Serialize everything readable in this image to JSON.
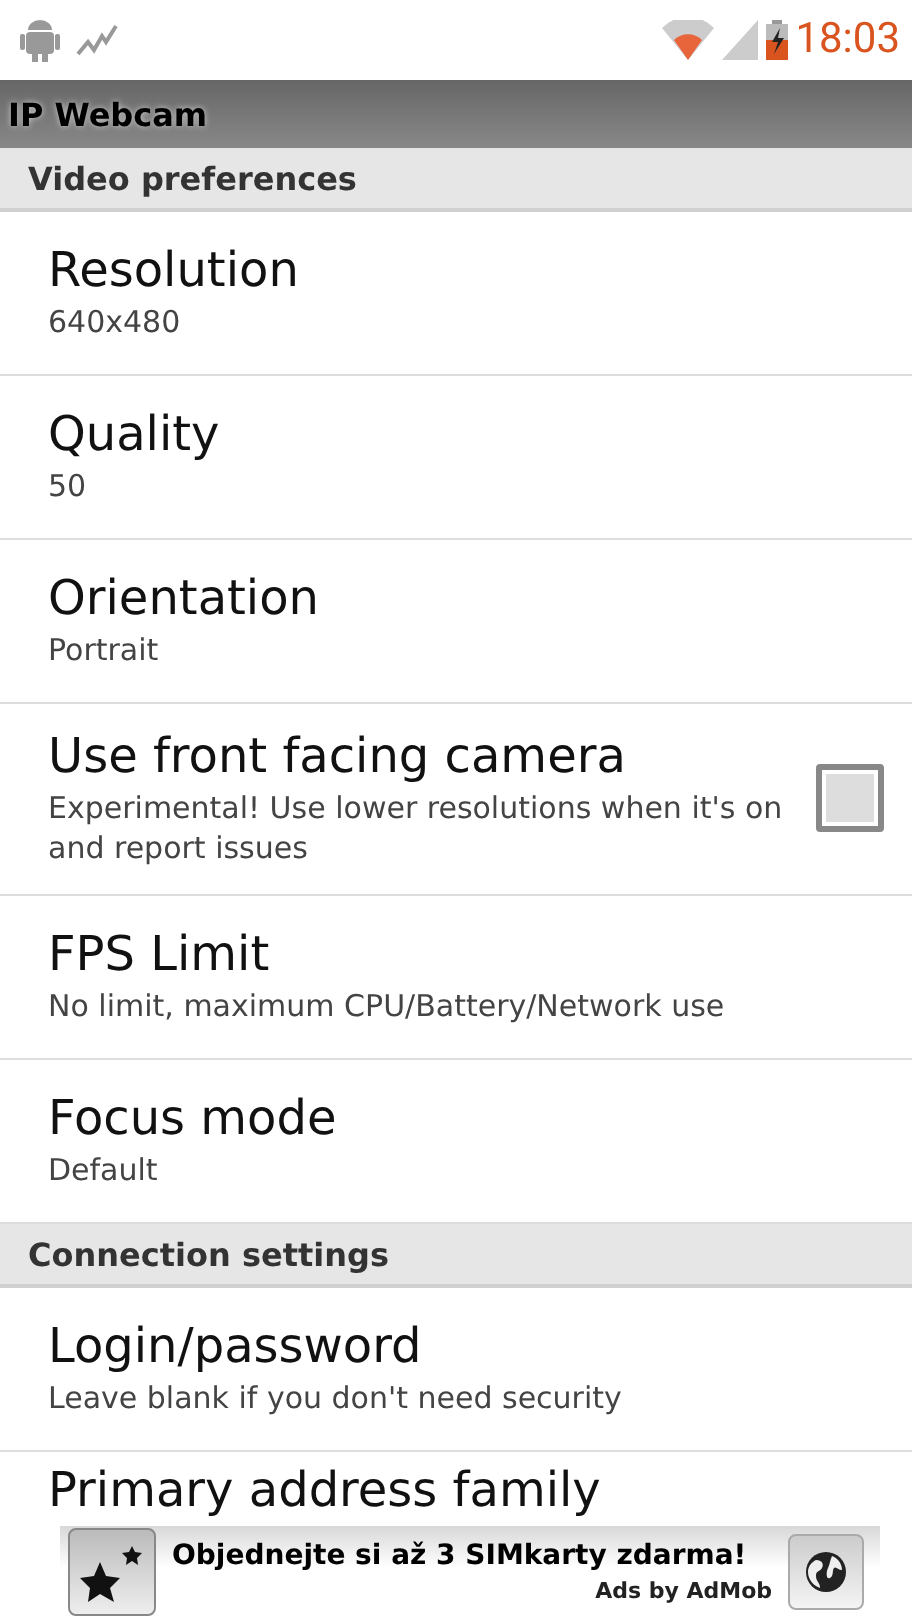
{
  "status_bar": {
    "time": "18:03"
  },
  "app_bar": {
    "title": "IP Webcam"
  },
  "sections": [
    {
      "title": "Video preferences",
      "items": [
        {
          "kind": "text",
          "title": "Resolution",
          "summary": "640x480"
        },
        {
          "kind": "text",
          "title": "Quality",
          "summary": "50"
        },
        {
          "kind": "text",
          "title": "Orientation",
          "summary": "Portrait"
        },
        {
          "kind": "checkbox",
          "title": "Use front facing camera",
          "summary": "Experimental! Use lower resolutions when it's on and report issues",
          "checked": false
        },
        {
          "kind": "text",
          "title": "FPS Limit",
          "summary": "No limit, maximum CPU/Battery/Network use"
        },
        {
          "kind": "text",
          "title": "Focus mode",
          "summary": "Default"
        }
      ]
    },
    {
      "title": "Connection settings",
      "items": [
        {
          "kind": "text",
          "title": "Login/password",
          "summary": "Leave blank if you don't need security"
        },
        {
          "kind": "text",
          "title": "Primary address family"
        }
      ]
    }
  ],
  "ad": {
    "headline": "Objednejte si až 3 SIMkarty zdarma!",
    "footer": "Ads by AdMob"
  }
}
